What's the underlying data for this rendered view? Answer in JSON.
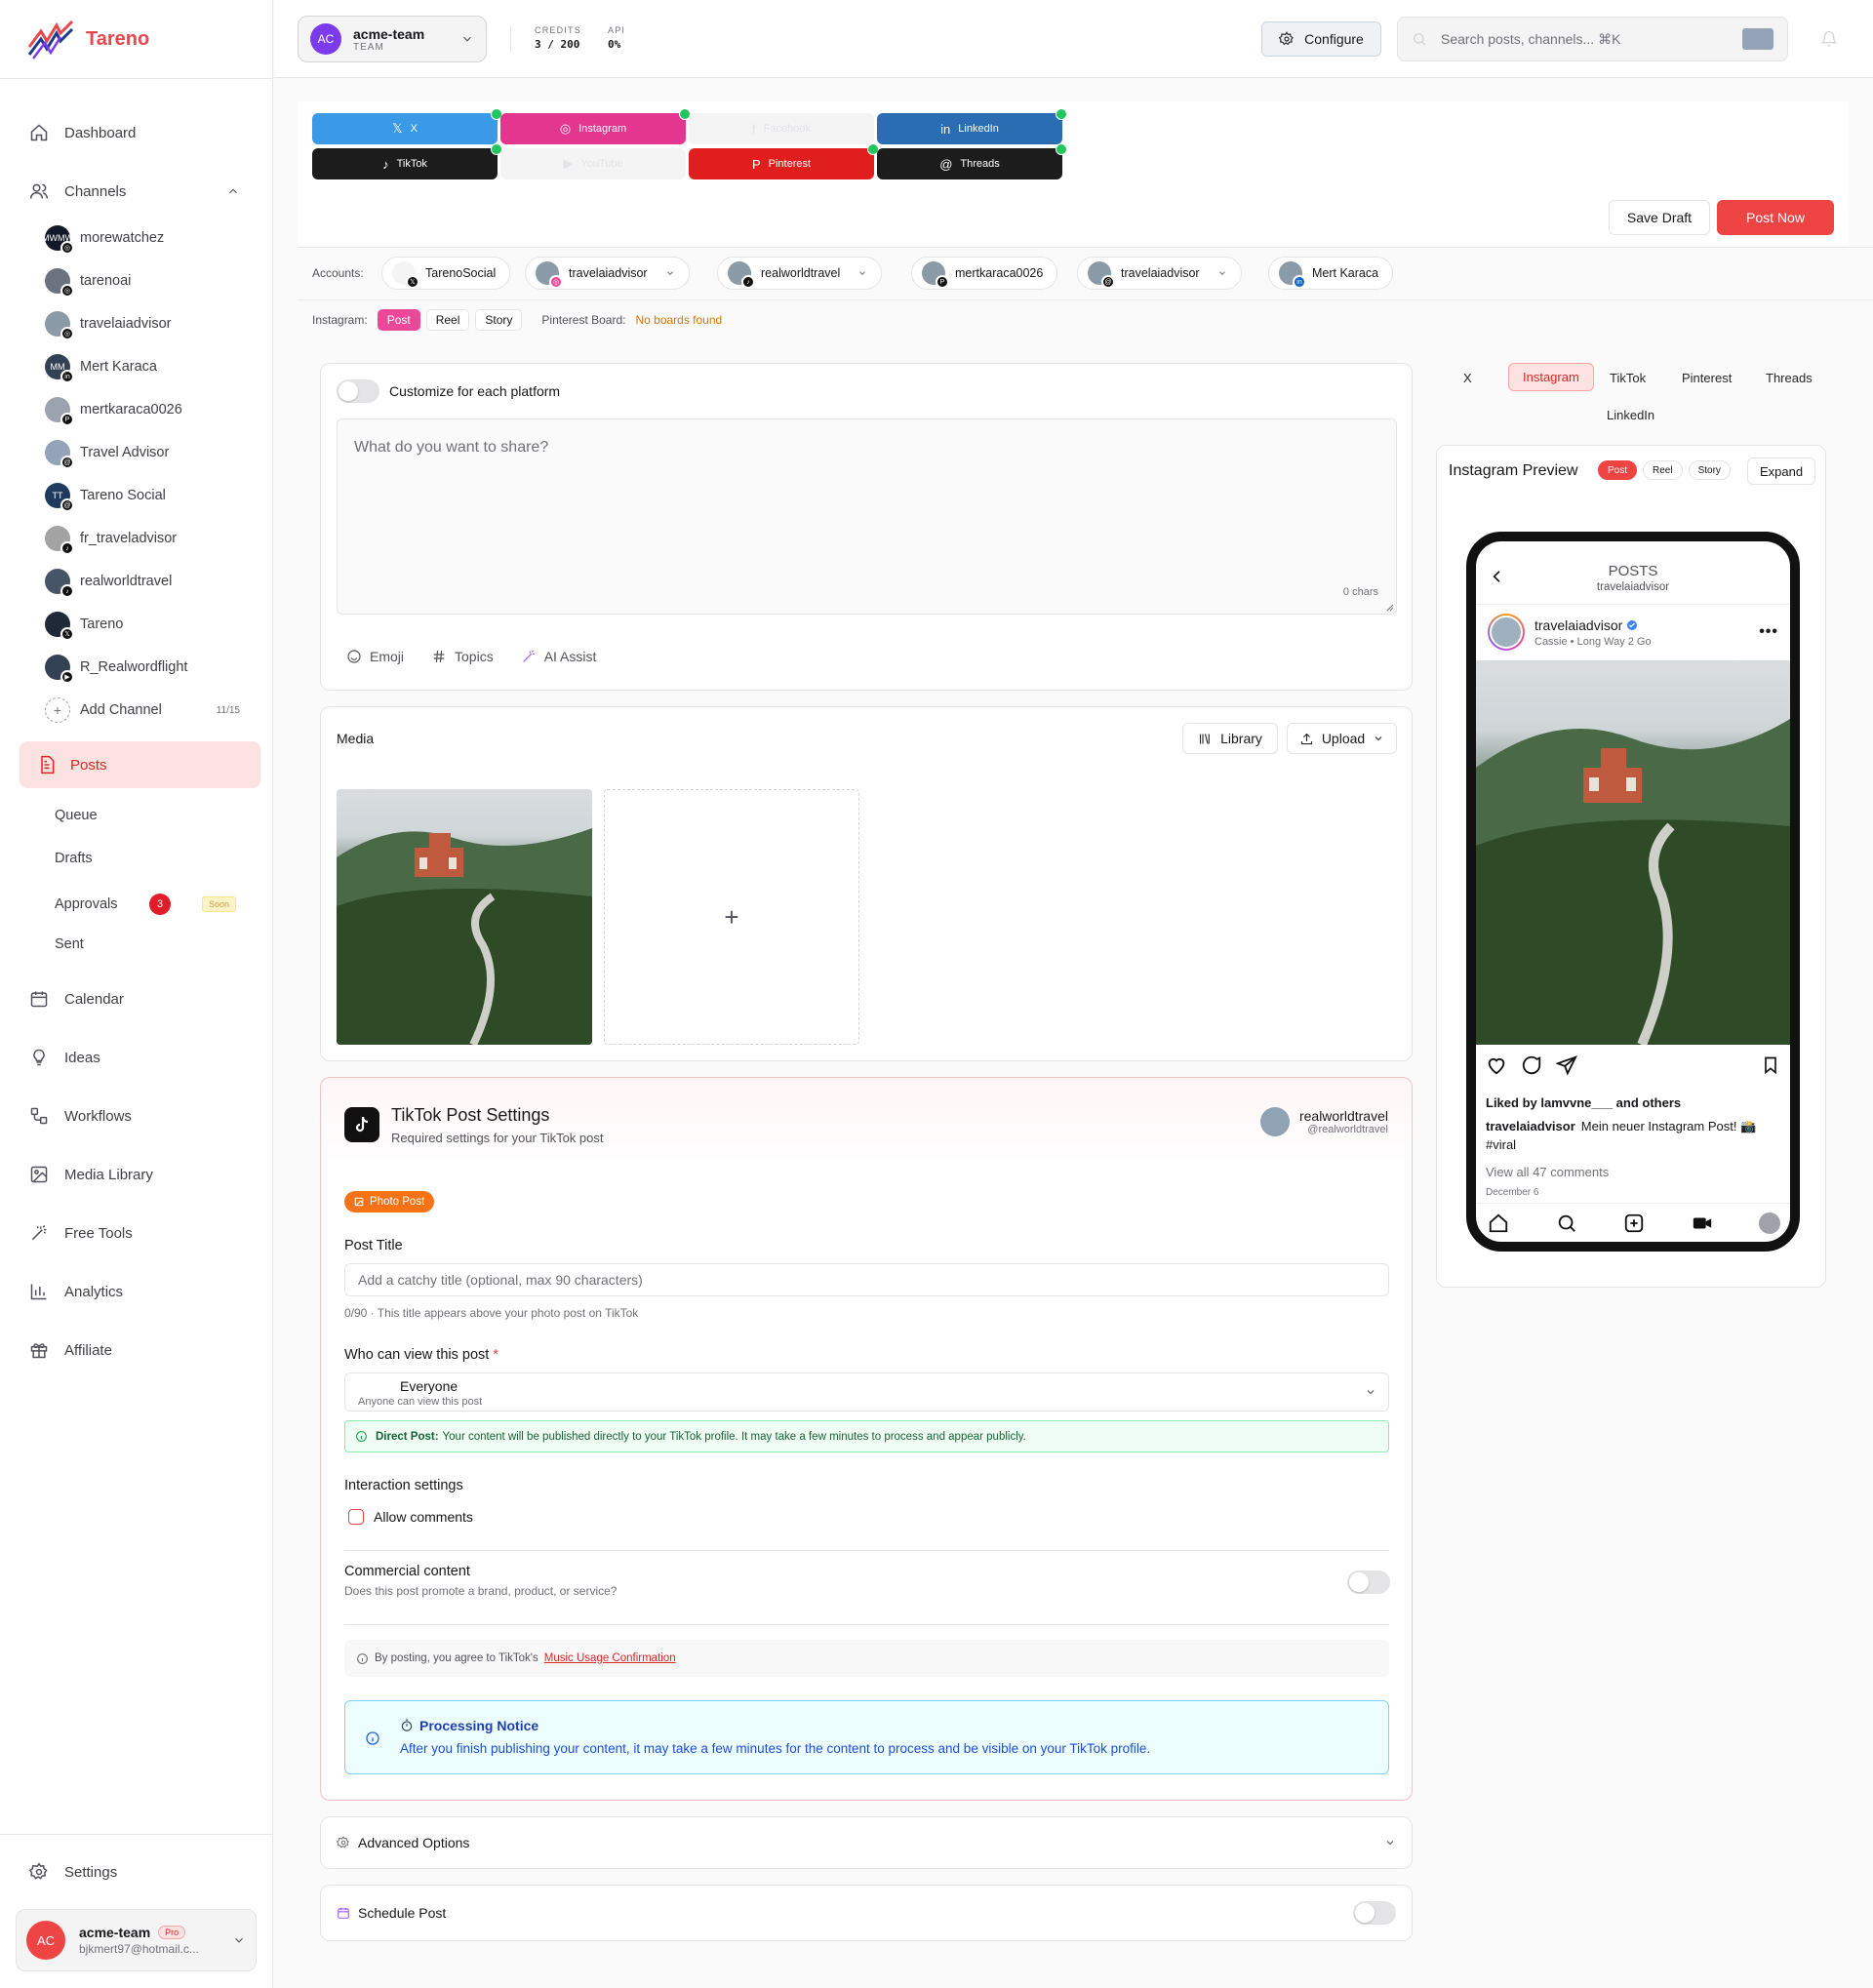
{
  "app": {
    "name": "Tareno"
  },
  "nav": {
    "dashboard": "Dashboard",
    "channels": "Channels",
    "posts": "Posts",
    "calendar": "Calendar",
    "ideas": "Ideas",
    "workflows": "Workflows",
    "media_library": "Media Library",
    "free_tools": "Free Tools",
    "analytics": "Analytics",
    "affiliate": "Affiliate",
    "settings": "Settings"
  },
  "channels": [
    {
      "name": "morewatchez",
      "initials": "MW",
      "platform": "instagram"
    },
    {
      "name": "tarenoai",
      "initials": "",
      "platform": "instagram"
    },
    {
      "name": "travelaiadvisor",
      "initials": "",
      "platform": "instagram"
    },
    {
      "name": "Mert Karaca",
      "initials": "M",
      "platform": "linkedin"
    },
    {
      "name": "mertkaraca0026",
      "initials": "",
      "platform": "pinterest"
    },
    {
      "name": "Travel Advisor",
      "initials": "",
      "platform": "threads"
    },
    {
      "name": "Tareno Social",
      "initials": "T",
      "platform": "threads"
    },
    {
      "name": "fr_traveladvisor",
      "initials": "",
      "platform": "tiktok"
    },
    {
      "name": "realworldtravel",
      "initials": "",
      "platform": "tiktok"
    },
    {
      "name": "Tareno",
      "initials": "",
      "platform": "x"
    },
    {
      "name": "R_Realwordflight",
      "initials": "",
      "platform": "youtube"
    }
  ],
  "add_channel": {
    "label": "Add Channel",
    "count": "11/15"
  },
  "posts_sub": {
    "queue": "Queue",
    "drafts": "Drafts",
    "approvals": "Approvals",
    "approvals_badge": "3",
    "soon": "Soon",
    "sent": "Sent"
  },
  "user": {
    "initials": "AC",
    "name": "acme-team",
    "plan": "Pro",
    "email": "bjkmert97@hotmail.c..."
  },
  "topbar": {
    "team_initials": "AC",
    "team_name": "acme-team",
    "team_role": "TEAM",
    "credits_label": "CREDITS",
    "credits_value": "3 / 200",
    "api_label": "API",
    "api_value": "0%",
    "configure": "Configure",
    "search_placeholder": "Search posts, channels... ⌘K"
  },
  "platforms": [
    {
      "label": "X",
      "color": "#3b9ae8",
      "selected": true
    },
    {
      "label": "Instagram",
      "color": "#e4358f",
      "selected": true
    },
    {
      "label": "Facebook",
      "color": "#f4f4f5",
      "selected": false
    },
    {
      "label": "LinkedIn",
      "color": "#2a6db3",
      "selected": true
    },
    {
      "label": "TikTok",
      "color": "#1c1c1c",
      "selected": true
    },
    {
      "label": "YouTube",
      "color": "#f4f4f5",
      "selected": false
    },
    {
      "label": "Pinterest",
      "color": "#e01e1e",
      "selected": true
    },
    {
      "label": "Threads",
      "color": "#1c1c1c",
      "selected": true
    }
  ],
  "actions": {
    "save_draft": "Save Draft",
    "post_now": "Post Now"
  },
  "accounts": {
    "label": "Accounts:",
    "items": [
      {
        "name": "TarenoSocial",
        "platform": "x",
        "dropdown": false
      },
      {
        "name": "travelaiadvisor",
        "platform": "instagram",
        "dropdown": true
      },
      {
        "name": "realworldtravel",
        "platform": "tiktok",
        "dropdown": true
      },
      {
        "name": "mertkaraca0026",
        "platform": "pinterest",
        "dropdown": false
      },
      {
        "name": "travelaiadvisor",
        "platform": "threads",
        "dropdown": true
      },
      {
        "name": "Mert Karaca",
        "platform": "linkedin",
        "dropdown": false
      }
    ]
  },
  "instagram_types": {
    "label": "Instagram:",
    "post": "Post",
    "reel": "Reel",
    "story": "Story",
    "board_label": "Pinterest Board:",
    "board_value": "No boards found"
  },
  "composer": {
    "customize_label": "Customize for each platform",
    "placeholder": "What do you want to share?",
    "chars": "0 chars",
    "emoji": "Emoji",
    "topics": "Topics",
    "ai_assist": "AI Assist"
  },
  "media": {
    "title": "Media",
    "library": "Library",
    "upload": "Upload",
    "add": "+"
  },
  "tiktok": {
    "title": "TikTok Post Settings",
    "subtitle": "Required settings for your TikTok post",
    "account_name": "realworldtravel",
    "account_handle": "@realworldtravel",
    "photo_post": "Photo Post",
    "post_title_label": "Post Title",
    "post_title_placeholder": "Add a catchy title (optional, max 90 characters)",
    "post_title_hint": "0/90 · This title appears above your photo post on TikTok",
    "who_label": "Who can view this post",
    "required": "*",
    "who_value": "Everyone",
    "who_desc": "Anyone can view this post",
    "direct_title": "Direct Post:",
    "direct_text": "Your content will be published directly to your TikTok profile. It may take a few minutes to process and appear publicly.",
    "interaction_label": "Interaction settings",
    "allow_comments": "Allow comments",
    "commercial_label": "Commercial content",
    "commercial_desc": "Does this post promote a brand, product, or service?",
    "agree_text": "By posting, you agree to TikTok's",
    "agree_link": "Music Usage Confirmation",
    "processing_title": "Processing Notice",
    "processing_text": "After you finish publishing your content, it may take a few minutes for the content to process and be visible on your TikTok profile."
  },
  "advanced": {
    "label": "Advanced Options"
  },
  "schedule": {
    "label": "Schedule Post"
  },
  "preview_tabs": [
    "X",
    "Instagram",
    "TikTok",
    "Pinterest",
    "Threads",
    "LinkedIn"
  ],
  "preview": {
    "title": "Instagram Preview",
    "post": "Post",
    "reel": "Reel",
    "story": "Story",
    "expand": "Expand",
    "header": "POSTS",
    "header_sub": "travelaiadvisor",
    "username": "travelaiadvisor",
    "location": "Cassie • Long Way 2 Go",
    "liked_by": "Liked by lamvvne___ and others",
    "caption_user": "travelaiadvisor",
    "caption": "Mein neuer Instagram Post! 📸 #viral",
    "comments": "View all 47 comments",
    "date": "December 6"
  }
}
